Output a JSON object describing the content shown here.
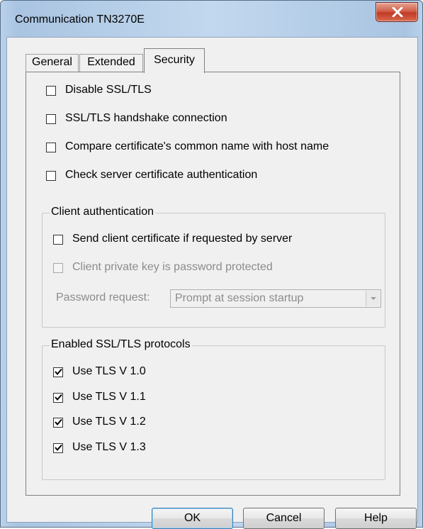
{
  "window": {
    "title": "Communication TN3270E",
    "close_icon": "close-x-icon"
  },
  "tabs": [
    {
      "label": "General",
      "active": false
    },
    {
      "label": "Extended",
      "active": false
    },
    {
      "label": "Security",
      "active": true
    }
  ],
  "security": {
    "options": [
      {
        "label": "Disable SSL/TLS",
        "checked": false,
        "enabled": true
      },
      {
        "label": "SSL/TLS handshake connection",
        "checked": false,
        "enabled": true
      },
      {
        "label": "Compare certificate's common name with host name",
        "checked": false,
        "enabled": true
      },
      {
        "label": "Check server certificate authentication",
        "checked": false,
        "enabled": true
      }
    ],
    "client_auth": {
      "title": "Client authentication",
      "send_cert": {
        "label": "Send client certificate if requested by server",
        "checked": false,
        "enabled": true
      },
      "private_key": {
        "label": "Client private key is password protected",
        "checked": false,
        "enabled": false
      },
      "password_request_label": "Password request:",
      "password_request_value": "Prompt at session startup"
    },
    "protocols": {
      "title": "Enabled SSL/TLS protocols",
      "items": [
        {
          "label": "Use TLS V 1.0",
          "checked": true
        },
        {
          "label": "Use TLS V 1.1",
          "checked": true
        },
        {
          "label": "Use TLS V 1.2",
          "checked": true
        },
        {
          "label": "Use TLS V 1.3",
          "checked": true
        }
      ]
    }
  },
  "buttons": {
    "ok": "OK",
    "cancel": "Cancel",
    "help": "Help"
  },
  "colors": {
    "dialog_bg": "#f0f0f0",
    "close_button": "#c23a25",
    "disabled_text": "#8c8c8c"
  }
}
